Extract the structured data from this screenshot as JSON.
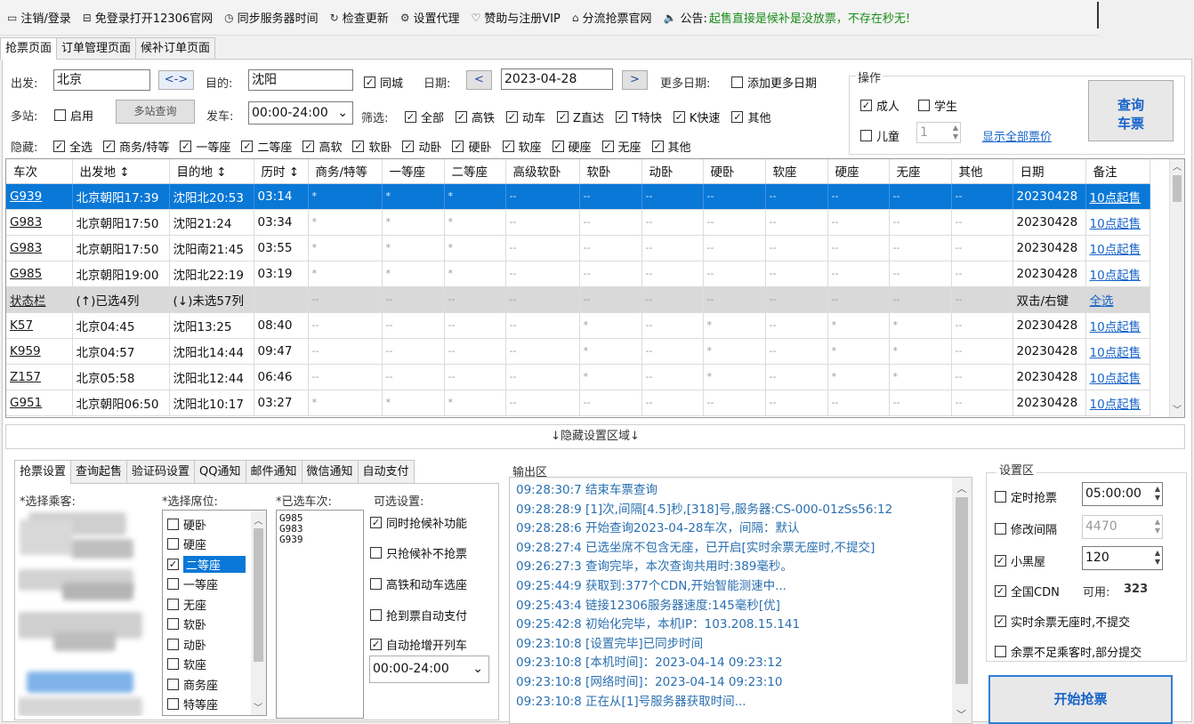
{
  "toolbar": {
    "items": [
      {
        "icon": "monitor-icon",
        "label": "注销/登录"
      },
      {
        "icon": "window-icon",
        "label": "免登录打开12306官网"
      },
      {
        "icon": "clock-icon",
        "label": "同步服务器时间"
      },
      {
        "icon": "refresh-icon",
        "label": "检查更新"
      },
      {
        "icon": "gear-icon",
        "label": "设置代理"
      },
      {
        "icon": "heart-icon",
        "label": "赞助与注册VIP"
      },
      {
        "icon": "home-icon",
        "label": "分流抢票官网"
      },
      {
        "icon": "speaker-icon",
        "label": "公告:"
      }
    ],
    "notice": "起售直接是候补是没放票，不存在秒无!"
  },
  "tabs": [
    "抢票页面",
    "订单管理页面",
    "候补订单页面"
  ],
  "query": {
    "from_label": "出发:",
    "from_value": "北京",
    "swap_label": "<->",
    "to_label": "目的:",
    "to_value": "沈阳",
    "same_city": "同城",
    "date_label": "日期:",
    "date_prev": "<",
    "date_value": "2023-04-28",
    "date_next": ">",
    "more_dates_label": "更多日期:",
    "add_more_dates": "添加更多日期",
    "multi_label": "多站:",
    "enable": "启用",
    "multi_query": "多站查询",
    "depart_label": "发车:",
    "depart_range": "00:00-24:00",
    "filter_label": "筛选:",
    "filters": [
      "全部",
      "高铁",
      "动车",
      "Z直达",
      "T特快",
      "K快速",
      "其他"
    ],
    "hide_label": "隐藏:",
    "hide_items": [
      "全选",
      "商务/特等",
      "一等座",
      "二等座",
      "高软",
      "软卧",
      "动卧",
      "硬卧",
      "软座",
      "硬座",
      "无座",
      "其他"
    ]
  },
  "ops": {
    "title": "操作",
    "adult": "成人",
    "student": "学生",
    "child": "儿童",
    "child_count": "1",
    "show_prices": "显示全部票价",
    "query_btn_line1": "查询",
    "query_btn_line2": "车票"
  },
  "grid": {
    "headers": [
      "车次",
      "出发地 ↕",
      "目的地 ↕",
      "历时 ↕",
      "商务/特等",
      "一等座",
      "二等座",
      "高级软卧",
      "软卧",
      "动卧",
      "硬卧",
      "软座",
      "硬座",
      "无座",
      "其他",
      "日期",
      "备注"
    ],
    "rows": [
      {
        "cells": [
          "G939",
          "北京朝阳17:39",
          "沈阳北20:53",
          "03:14",
          "*",
          "*",
          "*",
          "--",
          "--",
          "--",
          "--",
          "--",
          "--",
          "--",
          "--",
          "20230428",
          "10点起售"
        ],
        "selected": true
      },
      {
        "cells": [
          "G983",
          "北京朝阳17:50",
          "沈阳21:24",
          "03:34",
          "*",
          "*",
          "*",
          "--",
          "--",
          "--",
          "--",
          "--",
          "--",
          "--",
          "--",
          "20230428",
          "10点起售"
        ]
      },
      {
        "cells": [
          "G983",
          "北京朝阳17:50",
          "沈阳南21:45",
          "03:55",
          "*",
          "*",
          "*",
          "--",
          "--",
          "--",
          "--",
          "--",
          "--",
          "--",
          "--",
          "20230428",
          "10点起售"
        ]
      },
      {
        "cells": [
          "G985",
          "北京朝阳19:00",
          "沈阳北22:19",
          "03:19",
          "*",
          "*",
          "*",
          "--",
          "--",
          "--",
          "--",
          "--",
          "--",
          "--",
          "--",
          "20230428",
          "10点起售"
        ]
      },
      {
        "cells": [
          "状态栏",
          "(↑)已选4列",
          "(↓)未选57列",
          "",
          "--",
          "--",
          "--",
          "--",
          "--",
          "--",
          "--",
          "--",
          "--",
          "--",
          "--",
          "双击/右键",
          "全选"
        ],
        "status": true
      },
      {
        "cells": [
          "K57",
          "北京04:45",
          "沈阳13:25",
          "08:40",
          "--",
          "--",
          "--",
          "--",
          "*",
          "--",
          "*",
          "--",
          "*",
          "*",
          "--",
          "20230428",
          "10点起售"
        ]
      },
      {
        "cells": [
          "K959",
          "北京04:57",
          "沈阳北14:44",
          "09:47",
          "--",
          "--",
          "--",
          "--",
          "*",
          "--",
          "*",
          "--",
          "*",
          "*",
          "--",
          "20230428",
          "10点起售"
        ]
      },
      {
        "cells": [
          "Z157",
          "北京05:58",
          "沈阳北12:44",
          "06:46",
          "--",
          "--",
          "--",
          "--",
          "*",
          "--",
          "*",
          "--",
          "*",
          "*",
          "--",
          "20230428",
          "10点起售"
        ]
      },
      {
        "cells": [
          "G951",
          "北京朝阳06:50",
          "沈阳北10:17",
          "03:27",
          "*",
          "*",
          "*",
          "--",
          "--",
          "--",
          "--",
          "--",
          "--",
          "--",
          "--",
          "20230428",
          "10点起售"
        ]
      }
    ]
  },
  "hide_area": "↓隐藏设置区域↓",
  "bottom_tabs": [
    "抢票设置",
    "查询起售",
    "验证码设置",
    "QQ通知",
    "邮件通知",
    "微信通知",
    "自动支付"
  ],
  "settings": {
    "passenger_label": "*选择乘客:",
    "seat_label": "*选择席位:",
    "seats": [
      {
        "name": "硬卧",
        "checked": false
      },
      {
        "name": "硬座",
        "checked": false
      },
      {
        "name": "二等座",
        "checked": true,
        "selected": true
      },
      {
        "name": "一等座",
        "checked": false
      },
      {
        "name": "无座",
        "checked": false
      },
      {
        "name": "软卧",
        "checked": false
      },
      {
        "name": "动卧",
        "checked": false
      },
      {
        "name": "软座",
        "checked": false
      },
      {
        "name": "商务座",
        "checked": false
      },
      {
        "name": "特等座",
        "checked": false
      }
    ],
    "trains_label": "*已选车次:",
    "trains": [
      "G985",
      "G983",
      "G939"
    ],
    "optional_label": "可选设置:",
    "options": [
      {
        "name": "同时抢候补功能",
        "checked": true
      },
      {
        "name": "只抢候补不抢票",
        "checked": false
      },
      {
        "name": "高铁和动车选座",
        "checked": false
      },
      {
        "name": "抢到票自动支付",
        "checked": false
      },
      {
        "name": "自动抢增开列车",
        "checked": true
      }
    ],
    "time_range": "00:00-24:00"
  },
  "output": {
    "title": "输出区",
    "lines": [
      "09:28:30:7  结束车票查询",
      "09:28:28:9  [1]次,间隔[4.5]秒,[318]号,服务器:CS-000-01zSs56:12",
      "09:28:28:6  开始查询2023-04-28车次，间隔：默认",
      "09:28:27:4  已选坐席不包含无座，已开启[实时余票无座时,不提交]",
      "09:26:27:3  查询完毕，本次查询共用时:389毫秒。",
      "09:25:44:9  获取到:377个CDN,开始智能测速中...",
      "09:25:43:4  链接12306服务器速度:145毫秒[优]",
      "09:25:42:8  初始化完毕，本机IP：103.208.15.141",
      "09:23:10:8  [设置完毕]已同步时间",
      "09:23:10:8  [本机时间]：2023-04-14 09:23:12",
      "09:23:10:8  [网络时间]：2023-04-14 09:23:10",
      "09:23:10:8  正在从[1]号服务器获取时间..."
    ]
  },
  "setarea": {
    "title": "设置区",
    "timed_label": "定时抢票",
    "timed_value": "05:00:00",
    "interval_label": "修改间隔",
    "interval_value": "4470",
    "blackroom_label": "小黑屋",
    "blackroom_value": "120",
    "cdn_label": "全国CDN",
    "cdn_avail_label": "可用:",
    "cdn_avail": "323",
    "realtime_label": "实时余票无座时,不提交",
    "partial_label": "余票不足乘客时,部分提交",
    "start_btn": "开始抢票"
  }
}
